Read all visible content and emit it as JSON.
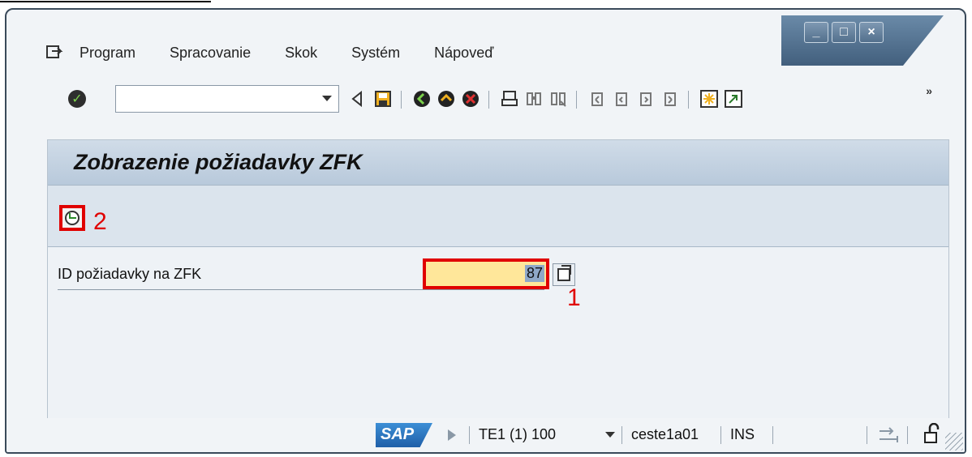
{
  "window": {
    "controls": {
      "minimize": "_",
      "maximize": "□",
      "close": "×"
    }
  },
  "menu": {
    "items": [
      "Program",
      "Spracovanie",
      "Skok",
      "Systém",
      "Nápoveď"
    ]
  },
  "toolbar": {
    "command_field_value": "",
    "more_label": "»",
    "icons": [
      "enter-icon",
      "back-icon",
      "save-icon",
      "back-nav-icon",
      "exit-icon",
      "cancel-icon",
      "print-icon",
      "find-icon",
      "find-next-icon",
      "first-page-icon",
      "prev-page-icon",
      "next-page-icon",
      "last-page-icon",
      "new-session-icon",
      "shortcut-icon"
    ]
  },
  "screen": {
    "title": "Zobrazenie požiadavky ZFK",
    "execute_button_annotation": "2",
    "field_label": "ID požiadavky na ZFK",
    "field_value": "87",
    "field_annotation": "1"
  },
  "status": {
    "system": "TE1 (1) 100",
    "server": "ceste1a01",
    "mode": "INS"
  },
  "colors": {
    "annotation_red": "#e00000",
    "field_yellow": "#ffe79a",
    "title_bar_blue": "#5f7c99"
  }
}
